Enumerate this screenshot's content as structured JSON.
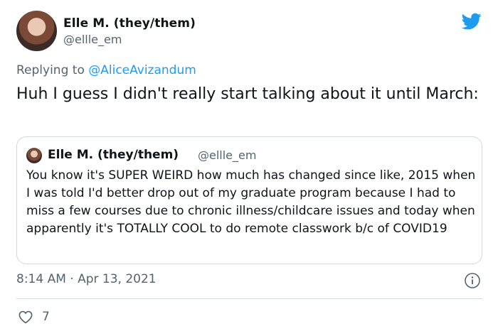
{
  "author": {
    "display_name": "Elle M. (they/them)",
    "handle": "@ellle_em"
  },
  "reply": {
    "prefix": "Replying to ",
    "mention": "@AliceAvizandum"
  },
  "tweet": {
    "text": "Huh I guess I didn't really start talking about it until March:"
  },
  "quoted_tweet": {
    "display_name": "Elle M. (they/them)",
    "handle": "@ellle_em",
    "text": "You know it's SUPER WEIRD how much has changed since like, 2015 when I was told I'd better drop out of my graduate program because I had to miss a few courses due to chronic illness/childcare issues and today when apparently it's TOTALLY COOL to do remote classwork b/c of COVID19"
  },
  "meta": {
    "timestamp": "8:14 AM · Apr 13, 2021"
  },
  "actions": {
    "like_count": "7"
  },
  "icons": {
    "brand": "twitter-bird-icon",
    "info": "info-icon",
    "like": "heart-icon"
  },
  "colors": {
    "accent": "#1d9bf0",
    "muted": "#536471",
    "border": "#cfd9de"
  }
}
